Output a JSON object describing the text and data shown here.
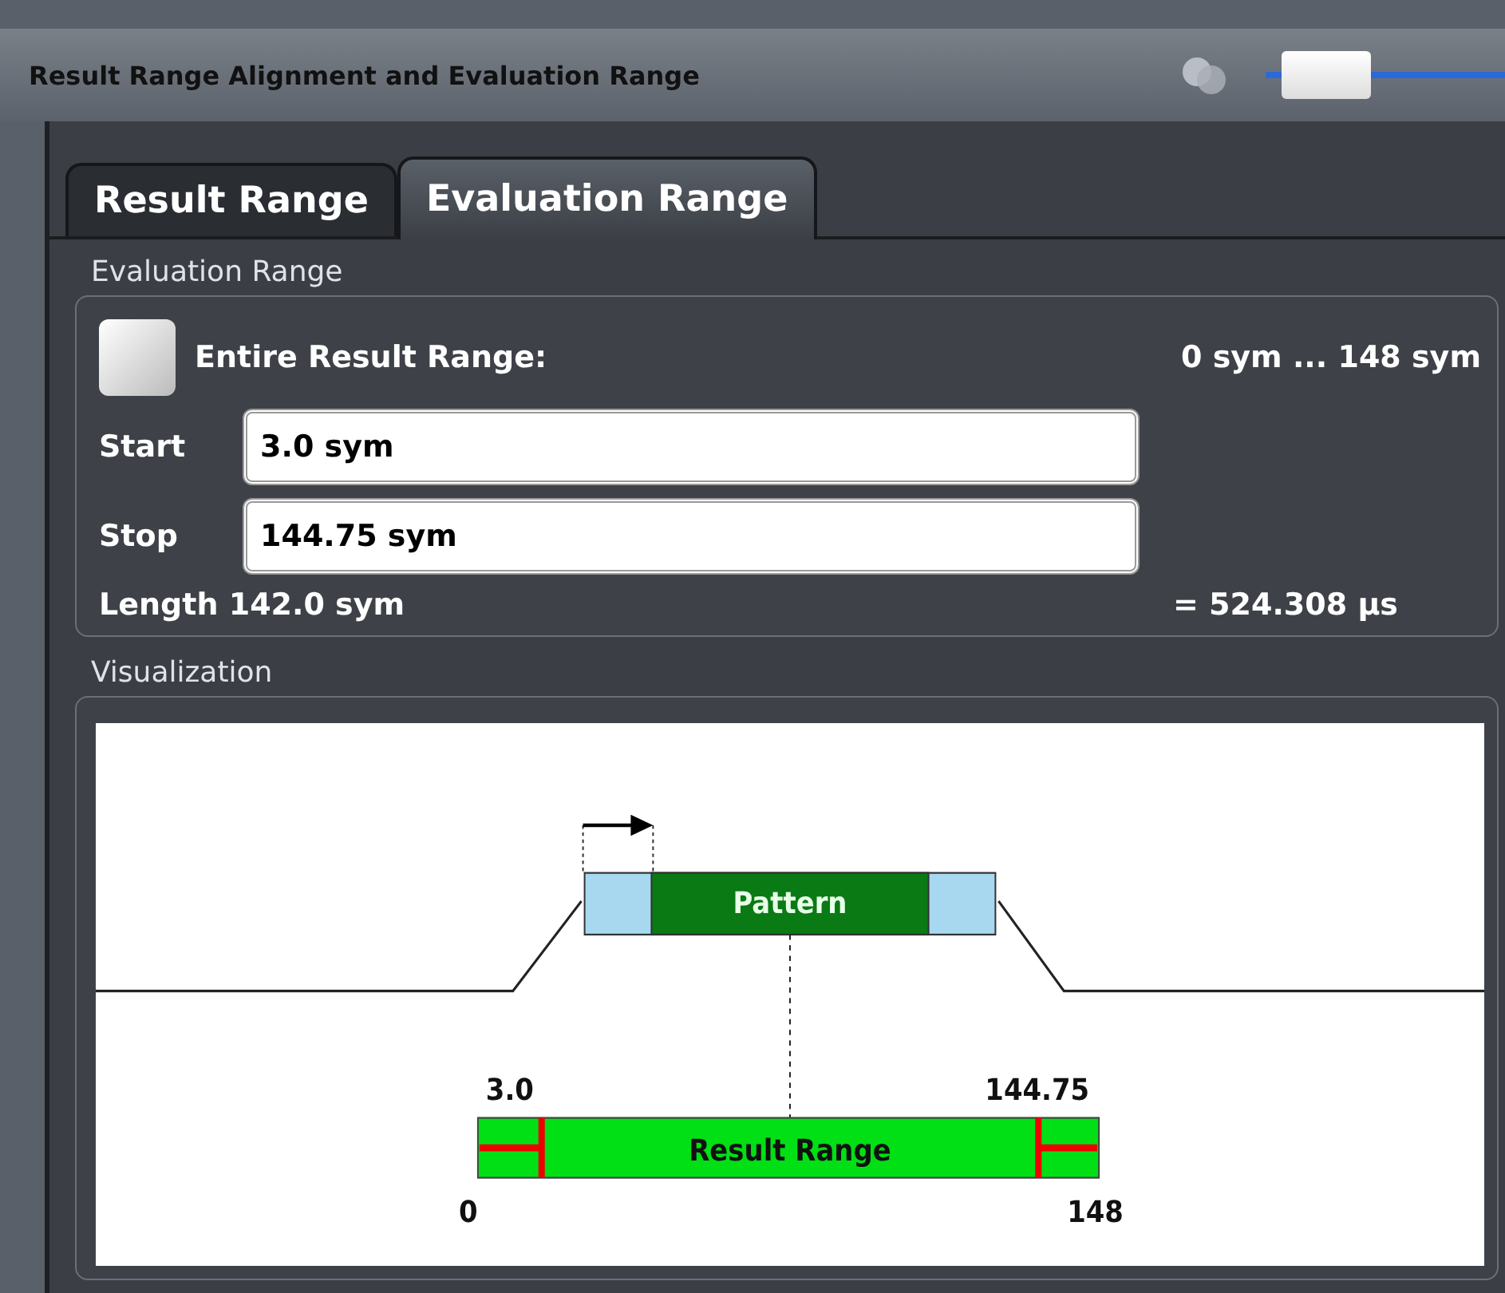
{
  "window": {
    "title": "Result Range Alignment and Evaluation Range",
    "toggle_on": true
  },
  "tabs": [
    {
      "label": "Result Range",
      "selected": false
    },
    {
      "label": "Evaluation Range",
      "selected": true
    }
  ],
  "evaluation_range": {
    "title": "Evaluation Range",
    "entire": {
      "label": "Entire Result Range:",
      "checked": false,
      "range": "0 sym ... 148 sym"
    },
    "fields": [
      {
        "label": "Start",
        "value": "3.0 sym"
      },
      {
        "label": "Stop",
        "value": "144.75 sym"
      }
    ],
    "length": "Length 142.0 sym",
    "duration": "= 524.308 µs"
  },
  "visualization": {
    "title": "Visualization",
    "pattern_label": "Pattern",
    "result_range_label": "Result Range",
    "start_value": "3.0",
    "stop_value": "144.75",
    "range_start": "0",
    "range_end": "148"
  }
}
